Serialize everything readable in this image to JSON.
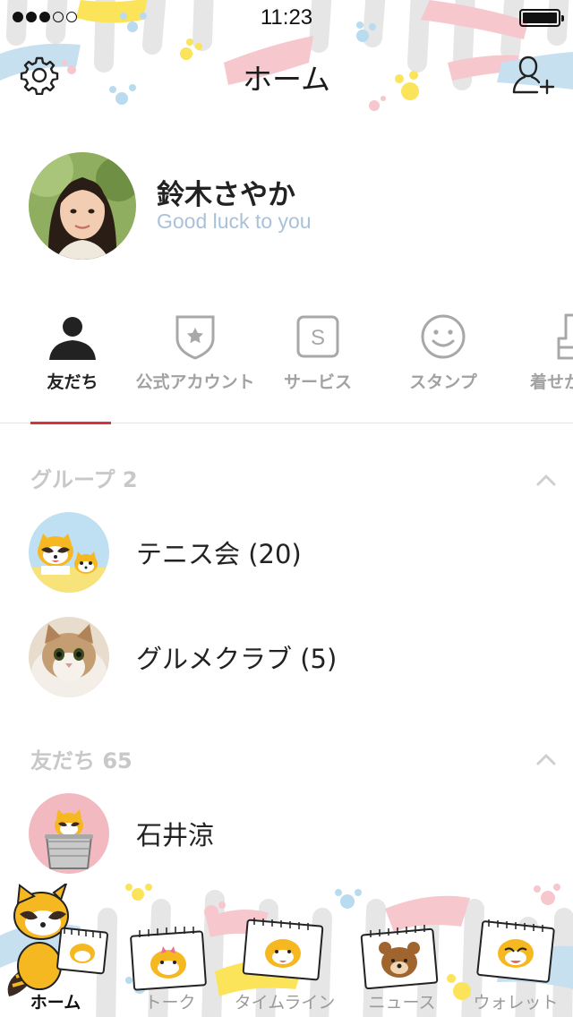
{
  "status_bar": {
    "time": "11:23",
    "signal_bars_filled": 3,
    "signal_bars_total": 5
  },
  "header": {
    "title": "ホーム",
    "settings_icon": "gear-icon",
    "add_friend_icon": "add-user-icon"
  },
  "profile": {
    "name": "鈴木さやか",
    "status_message": "Good luck to you"
  },
  "tabs": [
    {
      "label": "友だち",
      "icon": "person-icon",
      "active": true
    },
    {
      "label": "公式アカウント",
      "icon": "official-badge-icon",
      "active": false
    },
    {
      "label": "サービス",
      "icon": "service-icon",
      "active": false
    },
    {
      "label": "スタンプ",
      "icon": "smiley-icon",
      "active": false
    },
    {
      "label": "着せかえ",
      "icon": "brush-icon",
      "active": false
    }
  ],
  "groups": {
    "header": "グループ 2",
    "items": [
      {
        "name": "テニス会 (20)"
      },
      {
        "name": "グルメクラブ (5)"
      }
    ]
  },
  "friends": {
    "header": "友だち 65",
    "items": [
      {
        "name": "石井涼"
      }
    ]
  },
  "bottom_nav": [
    {
      "label": "ホーム",
      "active": true
    },
    {
      "label": "トーク",
      "active": false
    },
    {
      "label": "タイムライン",
      "active": false
    },
    {
      "label": "ニュース",
      "active": false
    },
    {
      "label": "ウォレット",
      "active": false
    }
  ],
  "colors": {
    "accent": "#d8333c",
    "status_message": "#a9c1d9",
    "section_header": "#c8c8c8",
    "pink": "#f4b8c0",
    "blue": "#b9dbef",
    "yellow": "#fbe35a"
  }
}
